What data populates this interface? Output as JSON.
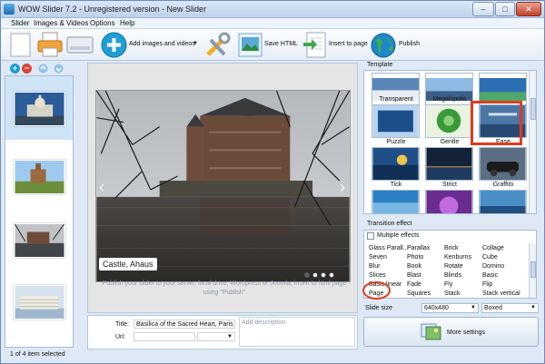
{
  "window": {
    "title": "WOW Slider 7.2 - Unregistered version - New Slider",
    "min_label": "–",
    "max_label": "□",
    "close_label": "✕"
  },
  "menu": [
    "Slider",
    "Images & Videos",
    "Options",
    "Help"
  ],
  "toolbar": {
    "add_label": "Add images and videos",
    "save_html_label": "Save HTML",
    "insert_label": "Insert to page",
    "publish_label": "Publish"
  },
  "left": {
    "add_symbol": "+",
    "remove_symbol": "−",
    "status": "1 of 4 item selected"
  },
  "preview": {
    "caption": "Castle, Ahaus",
    "prev_arrow": "‹",
    "next_arrow": "›",
    "help_line1": "Publish your slider to your server, local drive, Wordpress or Joomla, insert to html page",
    "help_line2": "using \"Publish\""
  },
  "fields": {
    "title_label": "Title:",
    "title_value": "Basilica of the Sacred Heart, Paris",
    "url_label": "Url:",
    "url_value": "",
    "desc_placeholder": "Add description"
  },
  "template": {
    "section_label": "Template",
    "names": [
      "Transparent",
      "Megalopolis",
      "Puzzle",
      "Gentle",
      "Ease",
      "Tick",
      "Strict",
      "Graffito"
    ]
  },
  "transition": {
    "section_label": "Transition effect",
    "multiple_label": "Multiple effects",
    "columns": [
      [
        "Glass Parall...",
        "Seven",
        "Blur",
        "Slices",
        "Basic linear",
        "Page"
      ],
      [
        "Parallax",
        "Photo",
        "Book",
        "Blast",
        "Fade",
        "Squares"
      ],
      [
        "Brick",
        "Kenburns",
        "Rotate",
        "Blinds",
        "Fly",
        "Stack"
      ],
      [
        "Collage",
        "Cube",
        "Domino",
        "Basic",
        "Flip",
        "Stack vertical"
      ]
    ]
  },
  "slide_size": {
    "label": "Slide size",
    "value": "640x480",
    "mode": "Boxed"
  },
  "more_settings_label": "More settings",
  "colors": {
    "accent": "#1f9ed6",
    "highlight": "#e03a1e"
  }
}
